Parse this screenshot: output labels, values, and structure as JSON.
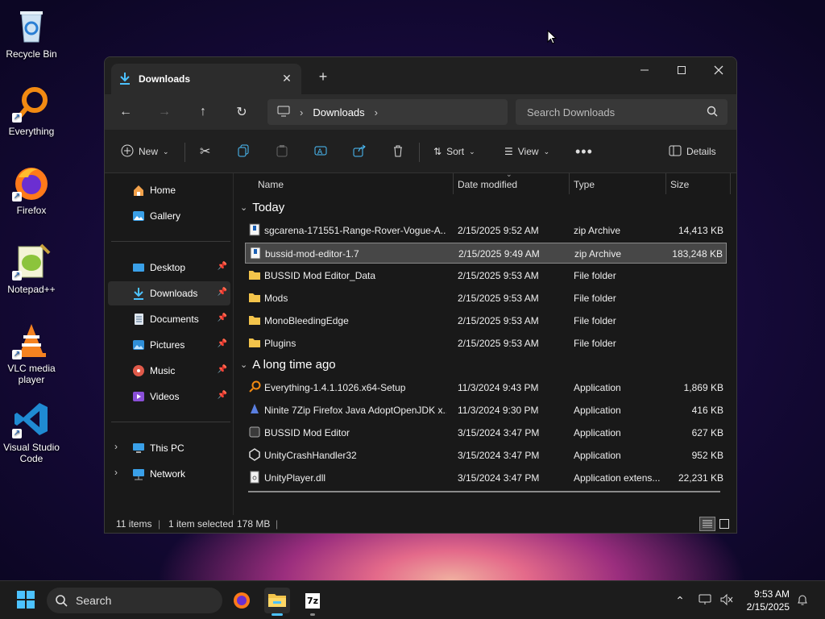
{
  "desktop": {
    "icons": [
      {
        "label": "Recycle Bin",
        "icon": "recycle-bin-icon"
      },
      {
        "label": "Everything",
        "icon": "everything-icon"
      },
      {
        "label": "Firefox",
        "icon": "firefox-icon"
      },
      {
        "label": "Notepad++",
        "icon": "notepad-plus-plus-icon"
      },
      {
        "label": "VLC media player",
        "icon": "vlc-icon"
      },
      {
        "label": "Visual Studio Code",
        "icon": "vscode-icon"
      }
    ]
  },
  "window": {
    "tab_title": "Downloads",
    "breadcrumb": {
      "current": "Downloads"
    },
    "search_placeholder": "Search Downloads",
    "toolbar": {
      "new_label": "New",
      "sort_label": "Sort",
      "view_label": "View",
      "details_label": "Details"
    },
    "sidebar": {
      "items": [
        {
          "label": "Home",
          "icon": "home-icon"
        },
        {
          "label": "Gallery",
          "icon": "gallery-icon"
        },
        {
          "label": "Desktop",
          "icon": "desktop-icon",
          "pinned": true
        },
        {
          "label": "Downloads",
          "icon": "downloads-icon",
          "pinned": true,
          "selected": true
        },
        {
          "label": "Documents",
          "icon": "documents-icon",
          "pinned": true
        },
        {
          "label": "Pictures",
          "icon": "pictures-icon",
          "pinned": true
        },
        {
          "label": "Music",
          "icon": "music-icon",
          "pinned": true
        },
        {
          "label": "Videos",
          "icon": "videos-icon",
          "pinned": true
        },
        {
          "label": "This PC",
          "icon": "this-pc-icon"
        },
        {
          "label": "Network",
          "icon": "network-icon"
        }
      ]
    },
    "columns": {
      "name": "Name",
      "date": "Date modified",
      "type": "Type",
      "size": "Size"
    },
    "groups": [
      {
        "label": "Today",
        "rows": [
          {
            "name": "sgcarena-171551-Range-Rover-Vogue-A...",
            "date": "2/15/2025 9:52 AM",
            "type": "zip Archive",
            "size": "14,413 KB",
            "icon": "zip-icon"
          },
          {
            "name": "bussid-mod-editor-1.7",
            "date": "2/15/2025 9:49 AM",
            "type": "zip Archive",
            "size": "183,248 KB",
            "icon": "zip-icon",
            "selected": true
          },
          {
            "name": "BUSSID Mod Editor_Data",
            "date": "2/15/2025 9:53 AM",
            "type": "File folder",
            "size": "",
            "icon": "folder-icon"
          },
          {
            "name": "Mods",
            "date": "2/15/2025 9:53 AM",
            "type": "File folder",
            "size": "",
            "icon": "folder-icon"
          },
          {
            "name": "MonoBleedingEdge",
            "date": "2/15/2025 9:53 AM",
            "type": "File folder",
            "size": "",
            "icon": "folder-icon"
          },
          {
            "name": "Plugins",
            "date": "2/15/2025 9:53 AM",
            "type": "File folder",
            "size": "",
            "icon": "folder-icon"
          }
        ]
      },
      {
        "label": "A long time ago",
        "rows": [
          {
            "name": "Everything-1.4.1.1026.x64-Setup",
            "date": "11/3/2024 9:43 PM",
            "type": "Application",
            "size": "1,869 KB",
            "icon": "everything-setup-icon"
          },
          {
            "name": "Ninite 7Zip Firefox Java AdoptOpenJDK x...",
            "date": "11/3/2024 9:30 PM",
            "type": "Application",
            "size": "416 KB",
            "icon": "ninite-icon"
          },
          {
            "name": "BUSSID Mod Editor",
            "date": "3/15/2024 3:47 PM",
            "type": "Application",
            "size": "627 KB",
            "icon": "app-icon"
          },
          {
            "name": "UnityCrashHandler32",
            "date": "3/15/2024 3:47 PM",
            "type": "Application",
            "size": "952 KB",
            "icon": "unity-icon"
          },
          {
            "name": "UnityPlayer.dll",
            "date": "3/15/2024 3:47 PM",
            "type": "Application extens...",
            "size": "22,231 KB",
            "icon": "dll-icon"
          }
        ]
      }
    ],
    "status": {
      "count": "11 items",
      "selected": "1 item selected",
      "size": "178 MB"
    }
  },
  "taskbar": {
    "search_label": "Search",
    "time": "9:53 AM",
    "date": "2/15/2025"
  },
  "colors": {
    "accent": "#4cc2ff",
    "folder": "#f3c44b",
    "window_bg": "#191919"
  }
}
